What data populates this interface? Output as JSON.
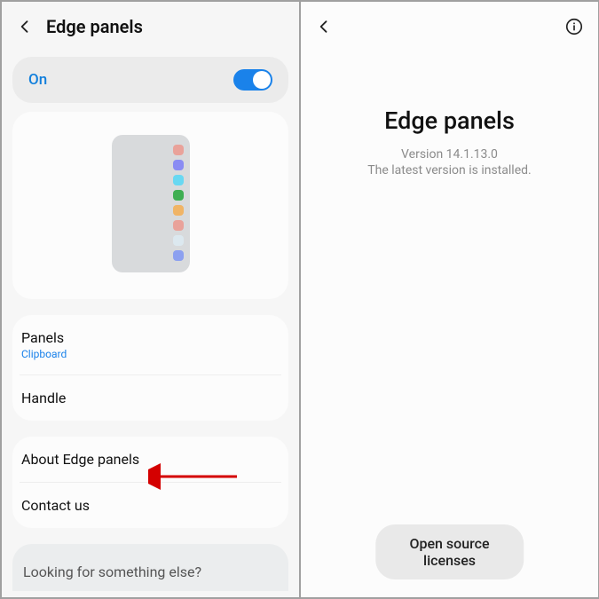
{
  "left": {
    "header_title": "Edge panels",
    "toggle_label": "On",
    "preview_colors": [
      "#e9a29a",
      "#8a8cf3",
      "#68d8f2",
      "#3fae52",
      "#f0b466",
      "#e9a29a",
      "#dce8ef",
      "#8ca0f0"
    ],
    "panels": {
      "label": "Panels",
      "sub": "Clipboard"
    },
    "handle_label": "Handle",
    "about_label": "About Edge panels",
    "contact_label": "Contact us",
    "looking_label": "Looking for something else?"
  },
  "right": {
    "title": "Edge panels",
    "version_label": "Version 14.1.13.0",
    "status_msg": "The latest version is installed.",
    "button_label": "Open source licenses"
  }
}
